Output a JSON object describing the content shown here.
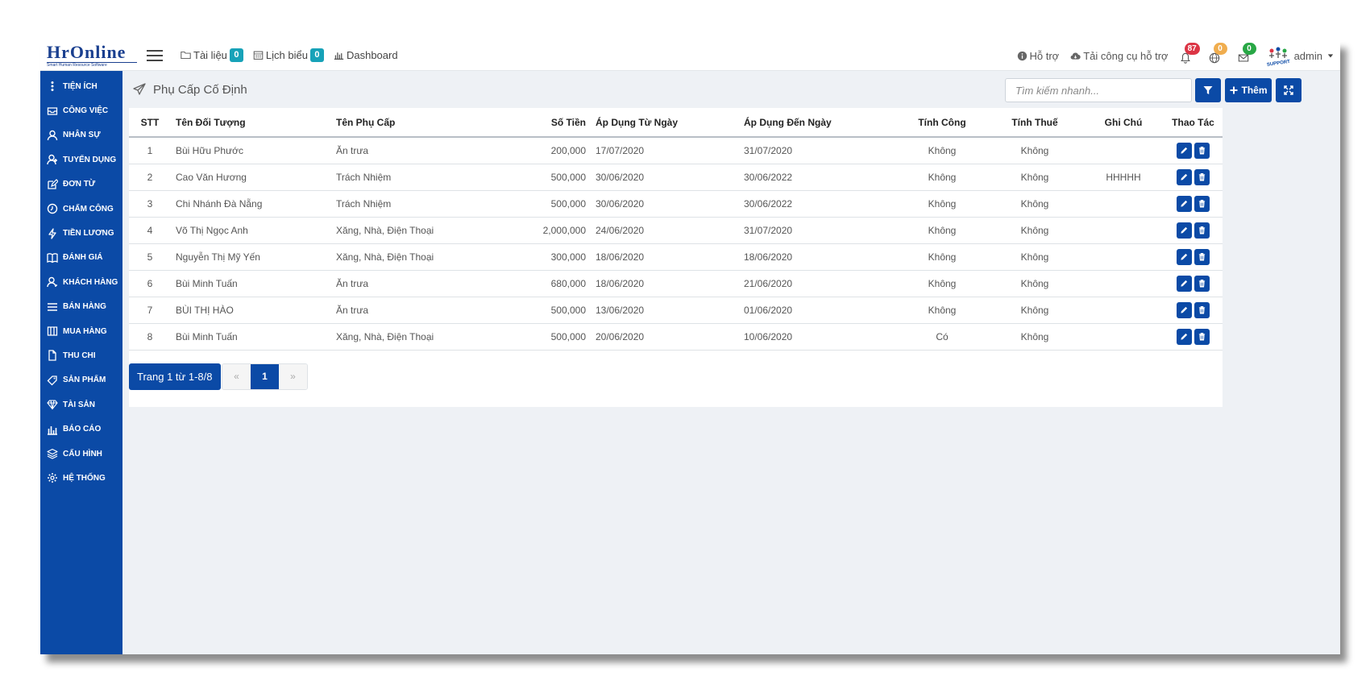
{
  "header": {
    "logo_name": "HrOnline",
    "logo_tagline": "Smart Human Resource Software",
    "nav": [
      {
        "label": "Tài liệu",
        "badge": "0"
      },
      {
        "label": "Lịch biểu",
        "badge": "0"
      },
      {
        "label": "Dashboard"
      }
    ],
    "support_label": "Hỗ trợ",
    "download_tool_label": "Tải công cụ hỗ trợ",
    "notifications": {
      "bell": "87",
      "globe": "0",
      "mail": "0"
    },
    "user": "admin",
    "avatar_text": "SUPPORT"
  },
  "sidebar": {
    "items": [
      {
        "label": "Tiện ích",
        "icon": "dots-vertical-icon"
      },
      {
        "label": "Công việc",
        "icon": "inbox-icon"
      },
      {
        "label": "Nhân sự",
        "icon": "user-icon"
      },
      {
        "label": "Tuyển dụng",
        "icon": "user-plus-icon"
      },
      {
        "label": "Đơn từ",
        "icon": "edit-icon"
      },
      {
        "label": "Chấm công",
        "icon": "clock-icon"
      },
      {
        "label": "Tiền lương",
        "icon": "bolt-icon"
      },
      {
        "label": "Đánh giá",
        "icon": "book-icon"
      },
      {
        "label": "Khách hàng",
        "icon": "customer-icon"
      },
      {
        "label": "Bán hàng",
        "icon": "list-icon"
      },
      {
        "label": "Mua hàng",
        "icon": "columns-icon"
      },
      {
        "label": "Thu chi",
        "icon": "file-icon"
      },
      {
        "label": "Sản phẩm",
        "icon": "tag-icon"
      },
      {
        "label": "Tài sản",
        "icon": "diamond-icon"
      },
      {
        "label": "Báo cáo",
        "icon": "chart-icon"
      },
      {
        "label": "Cấu hình",
        "icon": "layers-icon"
      },
      {
        "label": "Hệ thống",
        "icon": "gear-icon"
      }
    ]
  },
  "page": {
    "title": "Phụ Cấp Cố Định",
    "search_placeholder": "Tìm kiếm nhanh...",
    "add_label": "Thêm"
  },
  "table": {
    "columns": [
      "STT",
      "Tên Đối Tượng",
      "Tên Phụ Cấp",
      "Số Tiền",
      "Áp Dụng Từ Ngày",
      "Áp Dụng Đến Ngày",
      "Tính Công",
      "Tính Thuế",
      "Ghi Chú",
      "Thao Tác"
    ],
    "rows": [
      {
        "stt": "1",
        "name": "Bùi Hữu Phước",
        "allowance": "Ăn trưa",
        "amount": "200,000",
        "from": "17/07/2020",
        "to": "31/07/2020",
        "work": "Không",
        "tax": "Không",
        "note": ""
      },
      {
        "stt": "2",
        "name": "Cao Văn Hương",
        "allowance": "Trách Nhiệm",
        "amount": "500,000",
        "from": "30/06/2020",
        "to": "30/06/2022",
        "work": "Không",
        "tax": "Không",
        "note": "HHHHH"
      },
      {
        "stt": "3",
        "name": "Chi Nhánh Đà Nẵng",
        "allowance": "Trách Nhiệm",
        "amount": "500,000",
        "from": "30/06/2020",
        "to": "30/06/2022",
        "work": "Không",
        "tax": "Không",
        "note": ""
      },
      {
        "stt": "4",
        "name": "Võ Thị Ngọc Anh",
        "allowance": "Xăng, Nhà, Điện Thoại",
        "amount": "2,000,000",
        "from": "24/06/2020",
        "to": "31/07/2020",
        "work": "Không",
        "tax": "Không",
        "note": ""
      },
      {
        "stt": "5",
        "name": "Nguyễn Thị Mỹ Yến",
        "allowance": "Xăng, Nhà, Điện Thoại",
        "amount": "300,000",
        "from": "18/06/2020",
        "to": "18/06/2020",
        "work": "Không",
        "tax": "Không",
        "note": ""
      },
      {
        "stt": "6",
        "name": "Bùi Minh Tuấn",
        "allowance": "Ăn trưa",
        "amount": "680,000",
        "from": "18/06/2020",
        "to": "21/06/2020",
        "work": "Không",
        "tax": "Không",
        "note": ""
      },
      {
        "stt": "7",
        "name": "BÙI THỊ HÀO",
        "allowance": "Ăn trưa",
        "amount": "500,000",
        "from": "13/06/2020",
        "to": "01/06/2020",
        "work": "Không",
        "tax": "Không",
        "note": ""
      },
      {
        "stt": "8",
        "name": "Bùi Minh Tuấn",
        "allowance": "Xăng, Nhà, Điện Thoại",
        "amount": "500,000",
        "from": "20/06/2020",
        "to": "10/06/2020",
        "work": "Có",
        "tax": "Không",
        "note": ""
      }
    ]
  },
  "pagination": {
    "info": "Trang 1 từ 1-8/8",
    "prev": "«",
    "current": "1",
    "next": "»"
  },
  "colors": {
    "primary": "#0b4aa6",
    "badge_cyan": "#17a2b8",
    "badge_red": "#dc3545",
    "badge_orange": "#f0ad4e",
    "badge_green": "#28a745"
  }
}
